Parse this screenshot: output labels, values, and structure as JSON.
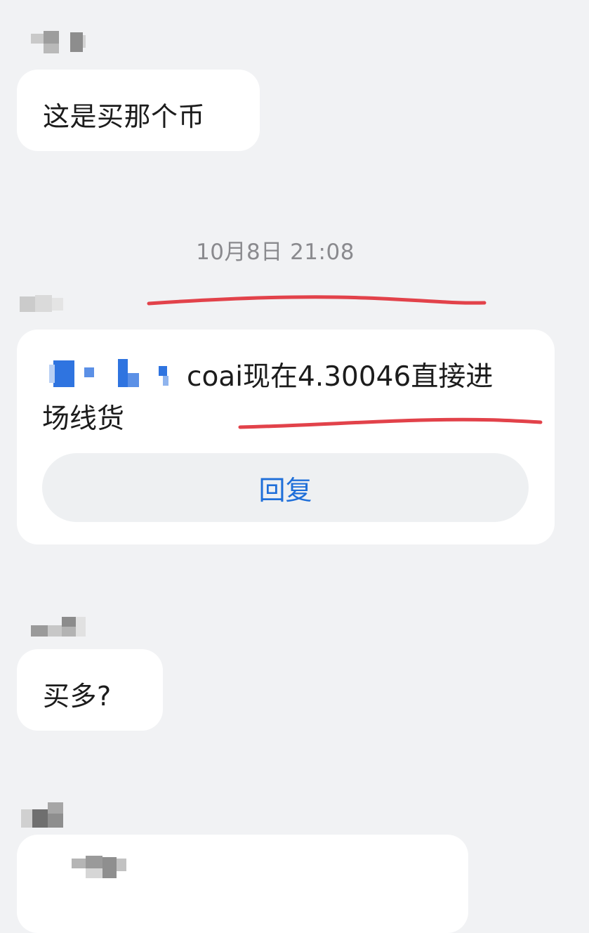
{
  "messages": [
    {
      "text": "这是买那个币"
    },
    {
      "text": "买多?"
    }
  ],
  "timestamp": "10月8日 21:08",
  "quoted_message": {
    "line1": "coai现在4.30046直接进",
    "line2": "场线货",
    "reply_label": "回复"
  },
  "colors": {
    "background": "#f1f2f4",
    "bubble": "#ffffff",
    "reply_text": "#1f6fd9",
    "annotation": "#e2424a",
    "mention_blur": "#2f74e0"
  }
}
